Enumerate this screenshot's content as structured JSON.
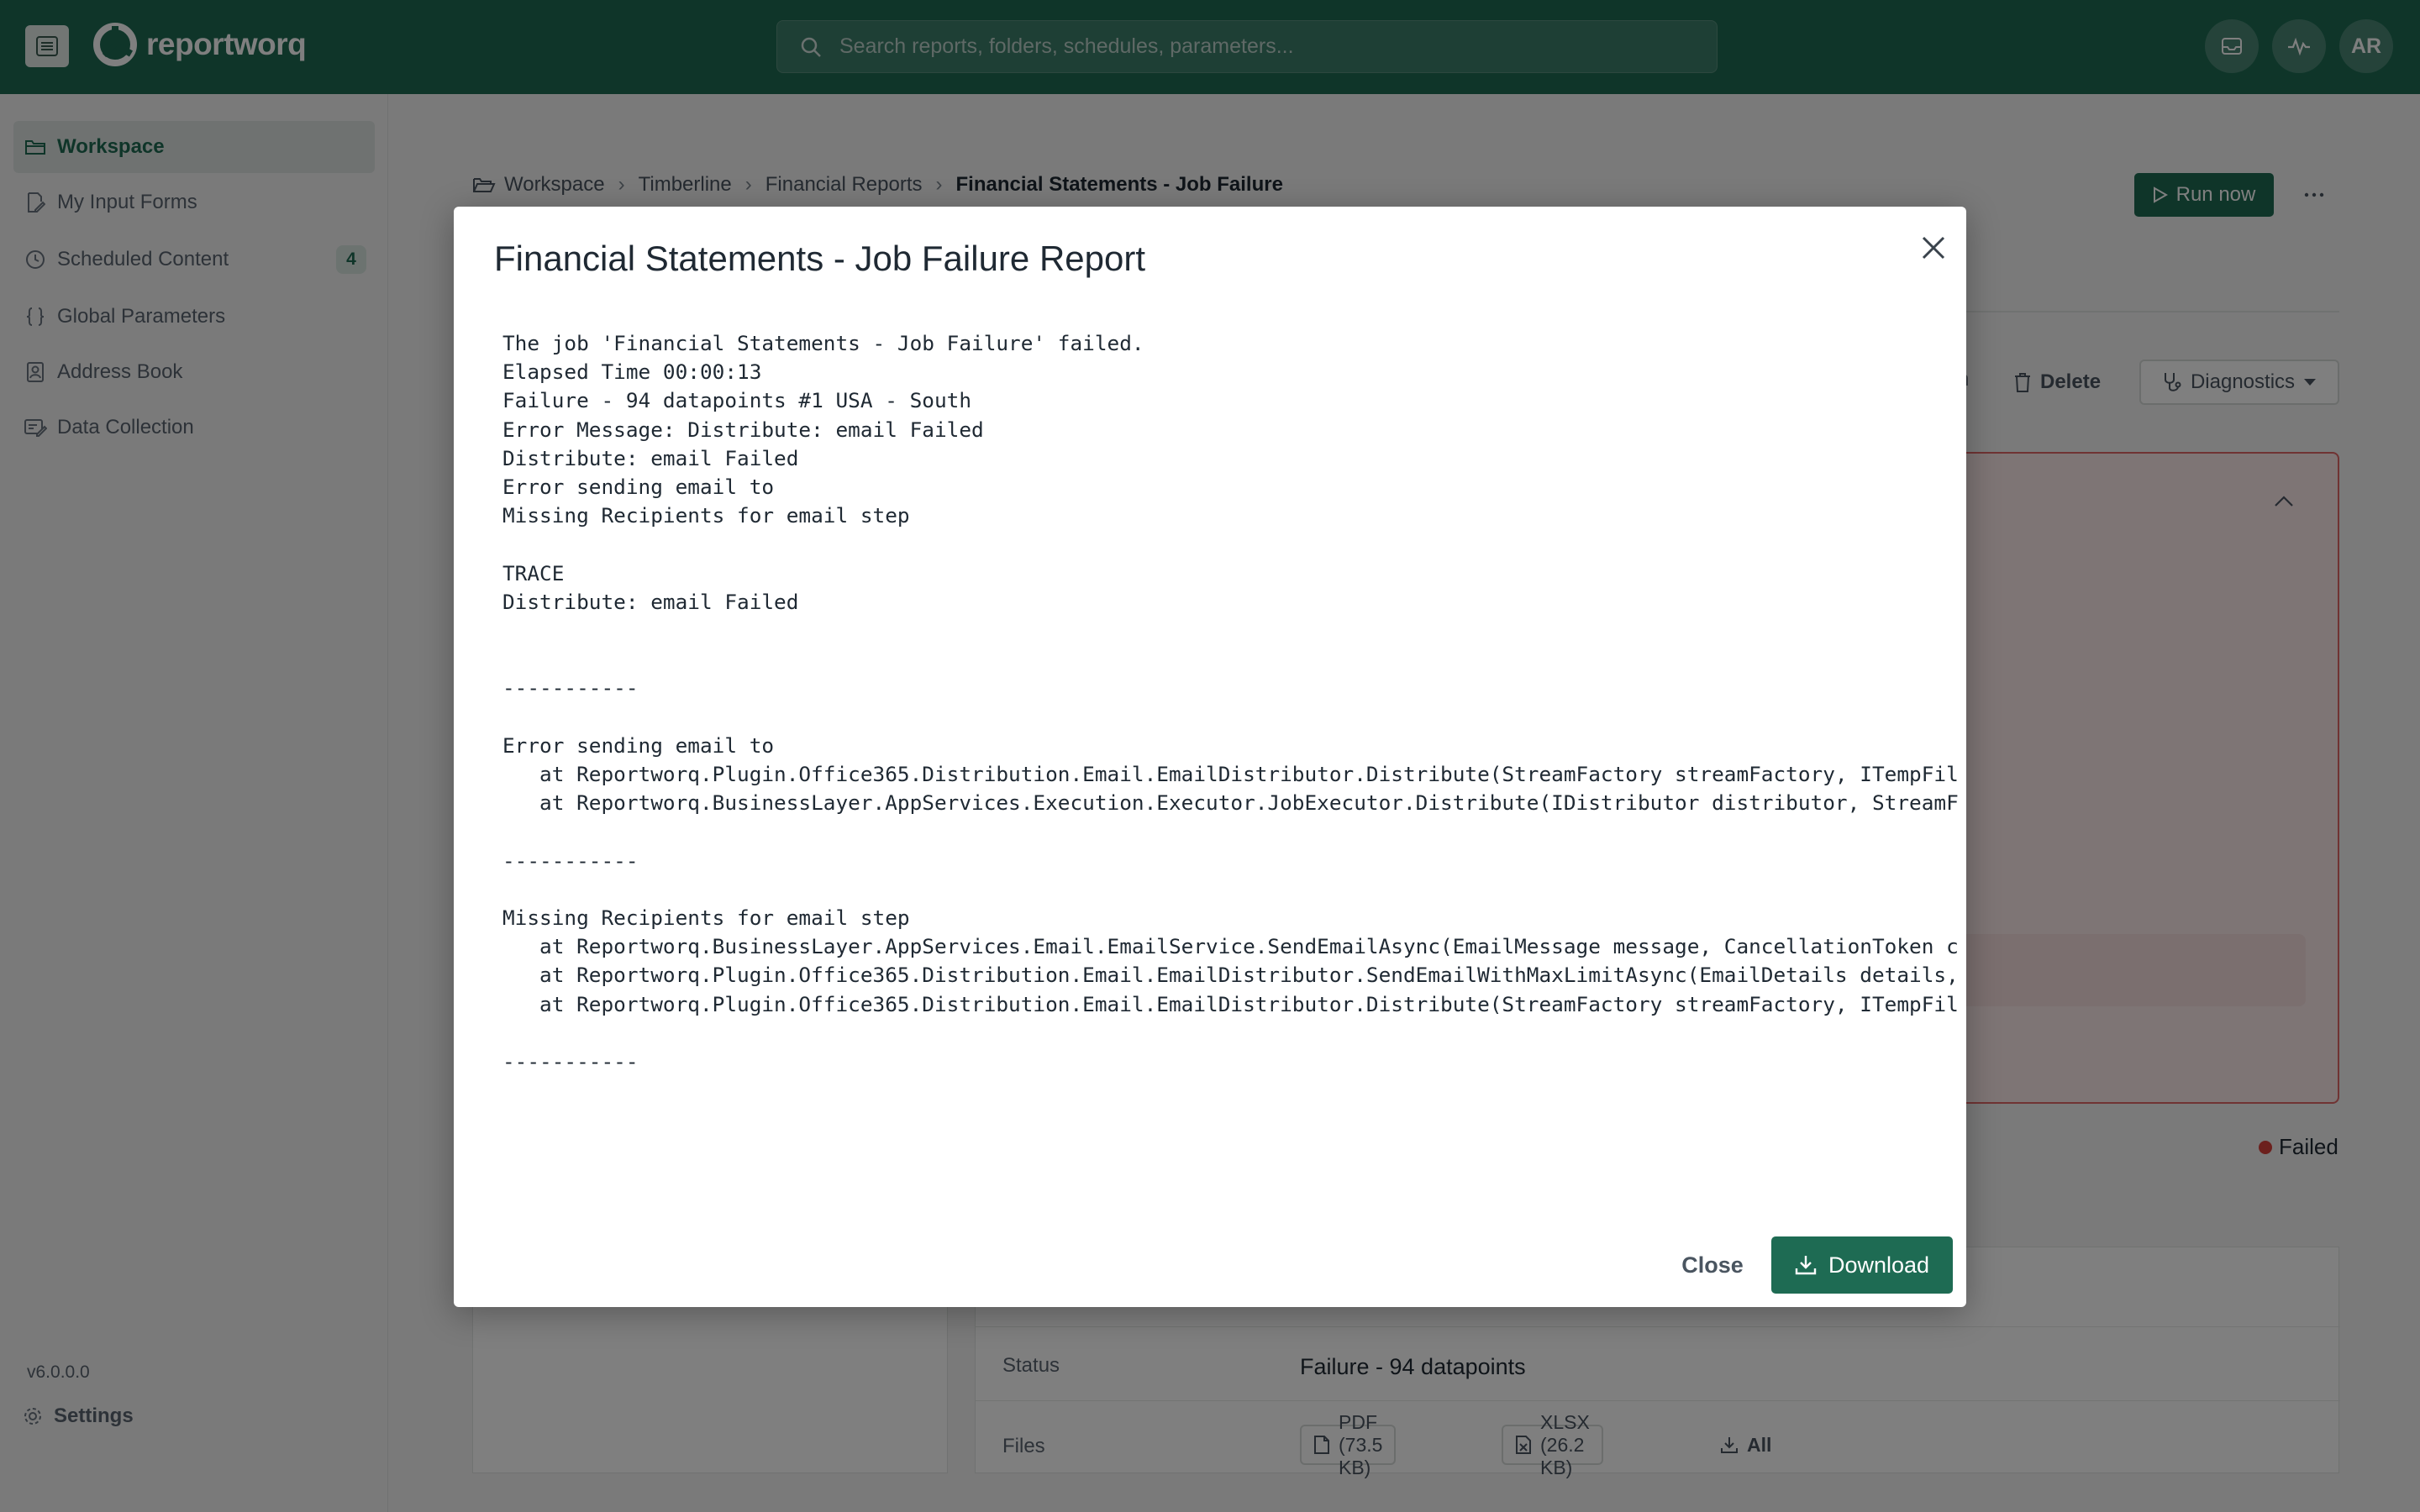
{
  "app": {
    "brand": "reportworq",
    "search_placeholder": "Search reports, folders, schedules, parameters...",
    "user_initials": "AR"
  },
  "sidebar": {
    "items": [
      {
        "label": "Workspace",
        "icon": "folder-icon",
        "active": true
      },
      {
        "label": "My Input Forms",
        "icon": "form-edit-icon"
      },
      {
        "label": "Scheduled Content",
        "icon": "clock-icon",
        "badge": "4"
      },
      {
        "label": "Global Parameters",
        "icon": "braces-icon"
      },
      {
        "label": "Address Book",
        "icon": "contact-book-icon"
      },
      {
        "label": "Data Collection",
        "icon": "data-edit-icon"
      }
    ],
    "settings_label": "Settings",
    "version": "v6.0.0.0"
  },
  "page": {
    "breadcrumb": [
      "Workspace",
      "Timberline",
      "Financial Reports",
      "Financial Statements - Job Failure"
    ],
    "run_now": "Run now",
    "partial_tab": "n",
    "delete": "Delete",
    "diagnostics": "Diagnostics",
    "status_badge": "Failed",
    "details": {
      "status_label": "Status",
      "status_value": "Failure - 94 datapoints",
      "files_label": "Files",
      "files": [
        "PDF (73.5 KB)",
        "XLSX (26.2 KB)"
      ],
      "all_label": "All"
    }
  },
  "modal": {
    "title": "Financial Statements - Job Failure Report",
    "log_lines": [
      "The job 'Financial Statements - Job Failure' failed.",
      "Elapsed Time 00:00:13",
      "Failure - 94 datapoints #1 USA - South",
      "Error Message: Distribute: email Failed",
      "Distribute: email Failed",
      "Error sending email to",
      "Missing Recipients for email step",
      "",
      "TRACE",
      "Distribute: email Failed",
      "",
      "",
      "-----------",
      "",
      "Error sending email to",
      "   at Reportworq.Plugin.Office365.Distribution.Email.EmailDistributor.Distribute(StreamFactory streamFactory, ITempFil",
      "   at Reportworq.BusinessLayer.AppServices.Execution.Executor.JobExecutor.Distribute(IDistributor distributor, StreamF",
      "",
      "-----------",
      "",
      "Missing Recipients for email step",
      "   at Reportworq.BusinessLayer.AppServices.Email.EmailService.SendEmailAsync(EmailMessage message, CancellationToken c",
      "   at Reportworq.Plugin.Office365.Distribution.Email.EmailDistributor.SendEmailWithMaxLimitAsync(EmailDetails details,",
      "   at Reportworq.Plugin.Office365.Distribution.Email.EmailDistributor.Distribute(StreamFactory streamFactory, ITempFil",
      "",
      "-----------"
    ],
    "close_label": "Close",
    "download_label": "Download"
  },
  "colors": {
    "brand": "#1e6b53",
    "error_border": "#e06666",
    "failed_dot": "#d9403a"
  }
}
